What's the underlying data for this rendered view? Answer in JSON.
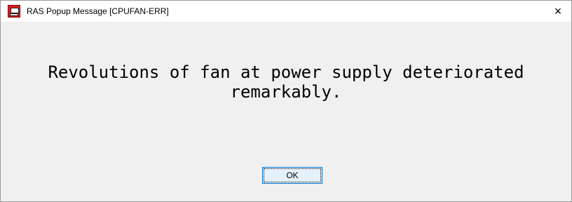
{
  "window": {
    "title": "RAS Popup Message [CPUFAN-ERR]",
    "app_icon": "ras-popup-app-icon",
    "close_label": "×"
  },
  "dialog": {
    "message": "Revolutions of fan at power supply deteriorated\nremarkably.",
    "ok_label": "OK"
  },
  "colors": {
    "titlebar_bg": "#ffffff",
    "client_bg": "#f0f0f0",
    "button_border": "#0078d7",
    "button_bg": "#e5f1fb",
    "app_icon_red": "#d62222"
  }
}
